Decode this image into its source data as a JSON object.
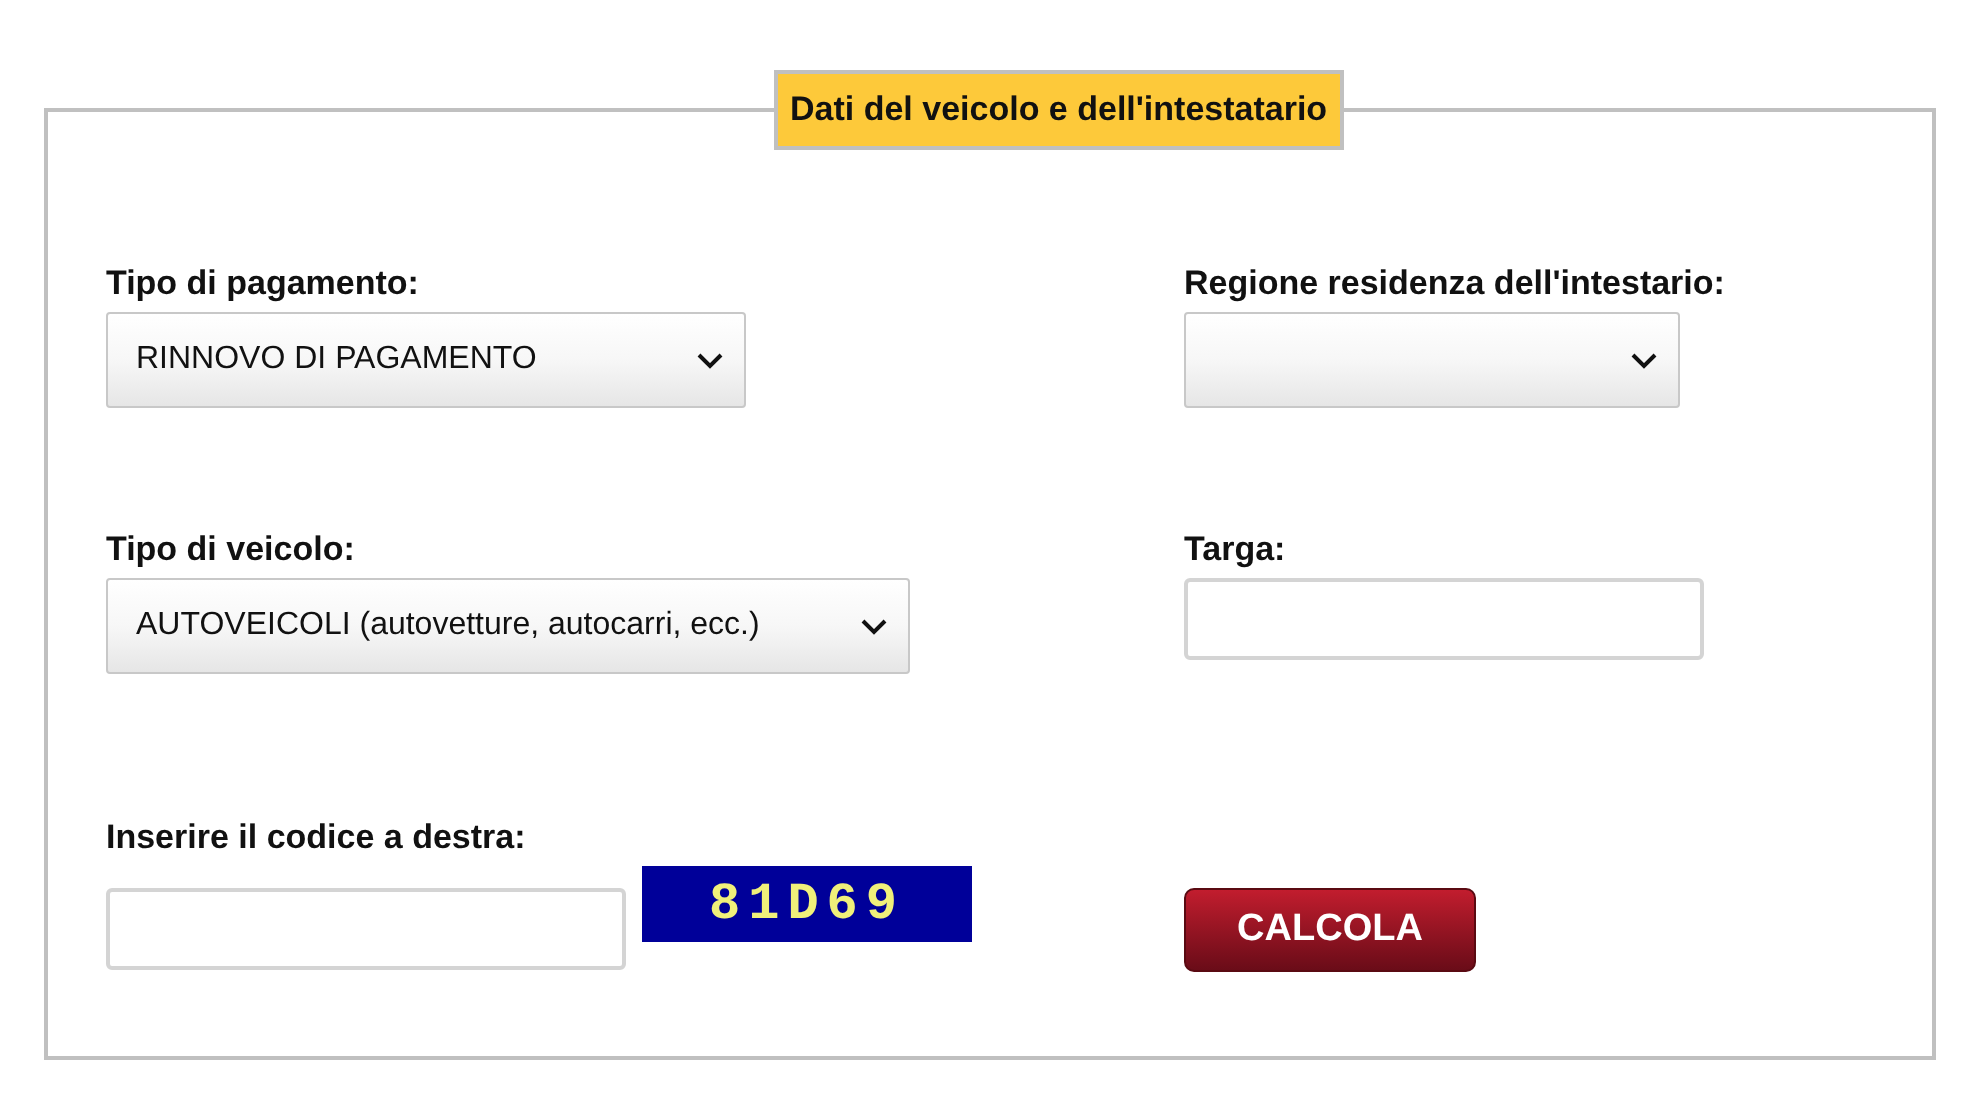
{
  "legend": "Dati del veicolo e dell'intestatario",
  "payment_type": {
    "label": "Tipo di pagamento:",
    "value": "RINNOVO DI PAGAMENTO"
  },
  "region": {
    "label": "Regione residenza dell'intestario:"
  },
  "vehicle_type": {
    "label": "Tipo di veicolo:",
    "value": "AUTOVEICOLI (autovetture, autocarri, ecc.)"
  },
  "plate": {
    "label": "Targa:"
  },
  "captcha": {
    "label": "Inserire il codice a destra:",
    "code": "81D69"
  },
  "submit": "CALCOLA"
}
